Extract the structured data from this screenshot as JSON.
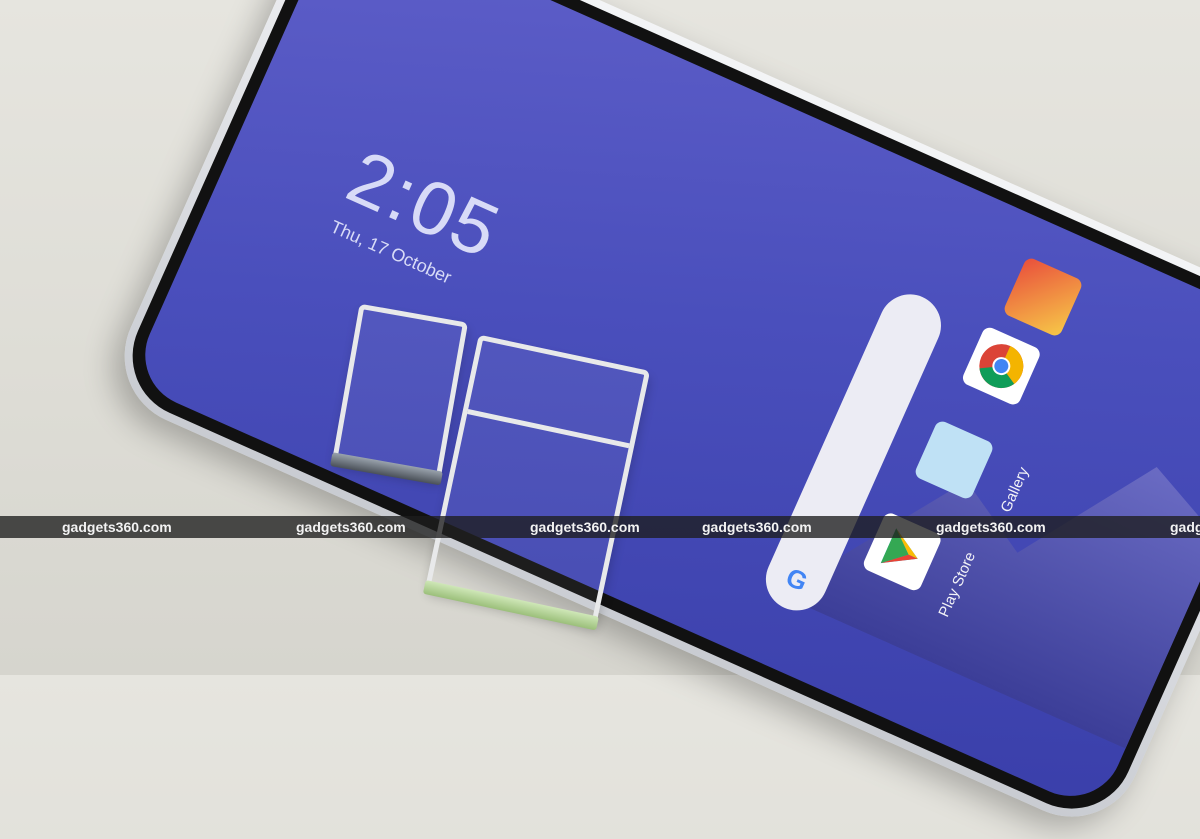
{
  "lockscreen": {
    "time": "2:05",
    "date": "Thu, 17 October"
  },
  "home_apps": [
    {
      "name": "Gallery",
      "icon": "gallery-icon"
    },
    {
      "name": "Play Store",
      "icon": "play-store-icon"
    },
    {
      "name": "",
      "icon": "chrome-icon"
    }
  ],
  "search_widget": {
    "icon": "google-g-icon",
    "glyph": "G"
  },
  "watermark": {
    "text": "gadgets360.com",
    "repeats": [
      "gadgets360.com",
      "gadgets360.com",
      "gadgets360.com",
      "gadgets360.com",
      "gadgets360.com",
      "gadg"
    ]
  },
  "colors": {
    "screen": "#4a4fbc",
    "background": "#e2e1da",
    "watermark_bar": "#1e1e1e"
  }
}
